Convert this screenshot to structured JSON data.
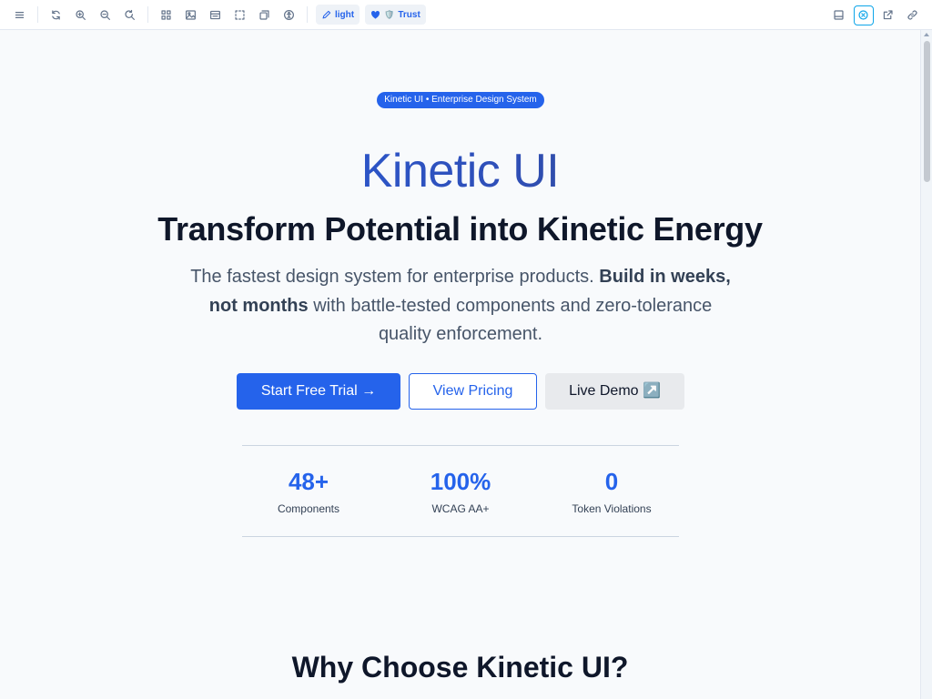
{
  "toolbar": {
    "theme_label": "light",
    "trust_label": "Trust",
    "trust_emoji": "🛡️",
    "accent": "#2563eb"
  },
  "hero": {
    "badge": "Kinetic UI • Enterprise Design System",
    "brand": "Kinetic UI",
    "headline": "Transform Potential into Kinetic Energy",
    "lead_part1": "The fastest design system for enterprise products. ",
    "lead_bold": "Build in weeks, not months",
    "lead_part2": " with battle-tested components and zero-tolerance quality enforcement.",
    "cta_primary": "Start Free Trial →",
    "cta_secondary": "View Pricing",
    "cta_ghost": "Live Demo ↗️"
  },
  "stats": [
    {
      "value": "48+",
      "label": "Components"
    },
    {
      "value": "100%",
      "label": "WCAG AA+"
    },
    {
      "value": "0",
      "label": "Token Violations"
    }
  ],
  "section": {
    "title": "Why Choose Kinetic UI?"
  }
}
